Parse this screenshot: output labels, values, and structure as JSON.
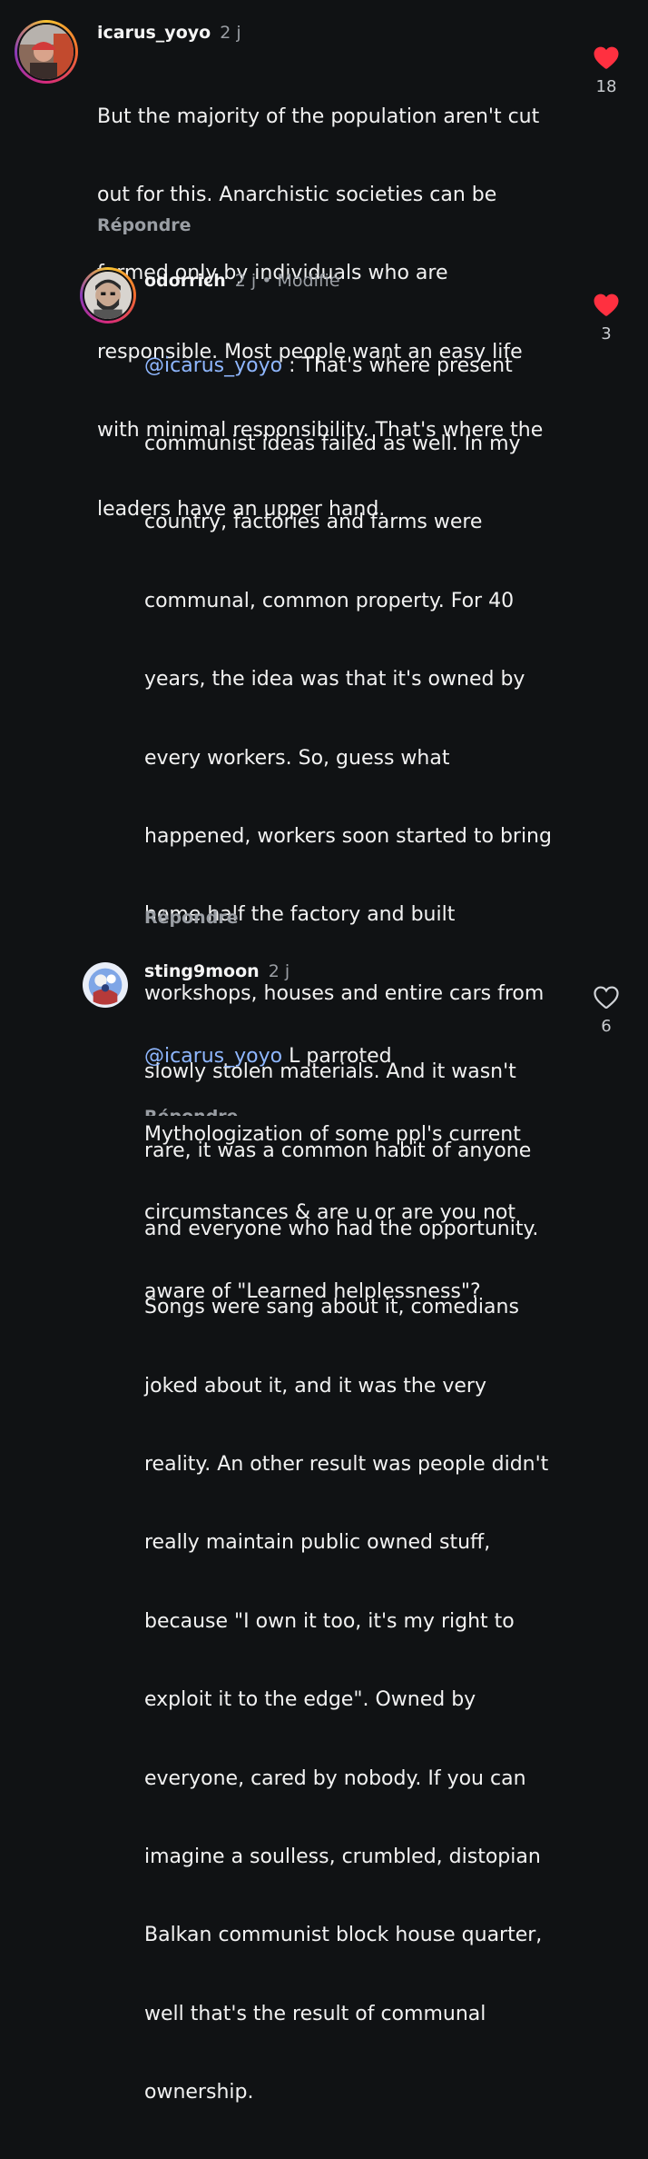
{
  "comments": [
    {
      "username": "icarus_yoyo",
      "time": "2 j",
      "lines": [
        "But the majority of the population aren't cut",
        "out for this. Anarchistic societies can be",
        "formed only by individuals who are",
        "responsible. Most people want an easy life",
        "with minimal responsibility. That's where the",
        "leaders have an upper hand."
      ],
      "reply_label": "Répondre",
      "likes": "18",
      "liked": true
    },
    {
      "username": "odorrich",
      "time": "2 j",
      "separator": "•",
      "edited": "Modifié",
      "mention": "@icarus_yoyo",
      "first_line_rest": " : That's where present",
      "lines": [
        "communist ideas failed as well. In my",
        "country, factories and farms were",
        "communal, common property. For 40",
        "years, the idea was that it's owned by",
        "every workers. So, guess what",
        "happened, workers soon started to bring",
        "home half the factory and built",
        "workshops, houses and entire cars from",
        "slowly stolen materials. And it wasn't",
        "rare, it was a common habit of anyone",
        "and everyone who had the opportunity.",
        "Songs were sang about it, comedians",
        "joked about it, and it was the very",
        "reality. An other result was people didn't",
        "really maintain public owned stuff,",
        "because \"I own it too, it's my right to",
        "exploit it to the edge\". Owned by",
        "everyone, cared by nobody. If you can",
        "imagine a soulless, crumbled, distopian",
        "Balkan communist block house quarter,",
        "well that's the result of communal",
        "ownership."
      ],
      "reply_label": "Répondre",
      "likes": "3",
      "liked": true
    },
    {
      "username": "sting9moon",
      "time": "2 j",
      "mention": "@icarus_yoyo",
      "first_line_rest": " L parroted",
      "lines": [
        "Mythologization of some ppl's current",
        "circumstances & are u or are you not",
        "aware of \"Learned helplessness\"?"
      ],
      "reply_label": "Répondre",
      "likes": "6",
      "liked": false
    }
  ],
  "colors": {
    "background": "#101214",
    "heart_liked": "#ff3040",
    "mention": "#8fb7ff",
    "muted": "#9a9ea4"
  }
}
